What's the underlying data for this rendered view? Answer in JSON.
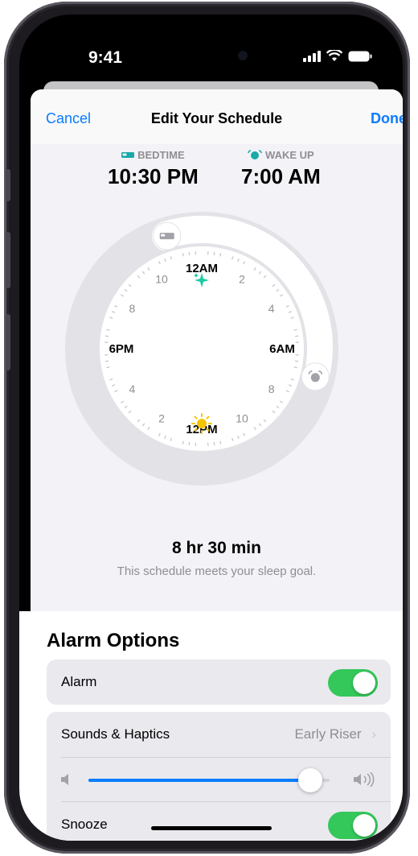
{
  "status_bar": {
    "time": "9:41"
  },
  "nav": {
    "cancel_label": "Cancel",
    "title": "Edit Your Schedule",
    "done_label": "Done"
  },
  "schedule": {
    "bedtime_label": "BEDTIME",
    "bedtime_value": "10:30 PM",
    "wake_label": "WAKE UP",
    "wake_value": "7:00 AM",
    "duration": "8 hr 30 min",
    "goal_text": "This schedule meets your sleep goal."
  },
  "clock": {
    "labels": [
      "12AM",
      "2",
      "4",
      "6AM",
      "8",
      "10",
      "12PM",
      "2",
      "4",
      "6PM",
      "8",
      "10"
    ],
    "accent_bedtime": "#1aa8a8",
    "accent_wake": "#f5c400"
  },
  "alarm_options": {
    "title": "Alarm Options",
    "alarm_label": "Alarm",
    "alarm_on": true,
    "sounds_label": "Sounds & Haptics",
    "sounds_value": "Early Riser",
    "volume_level": 0.92,
    "snooze_label": "Snooze",
    "snooze_on": true
  },
  "colors": {
    "accent": "#0a7cff",
    "toggle_on": "#34c759"
  }
}
